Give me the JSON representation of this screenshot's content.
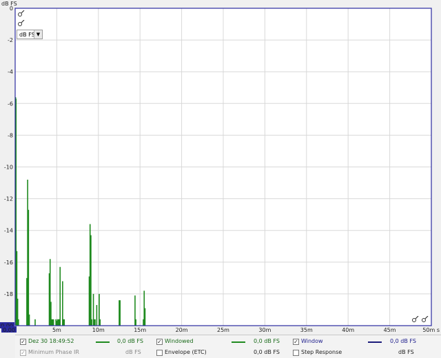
{
  "chart_data": {
    "type": "bar",
    "ylabel": "dB FS",
    "xlabel": "s",
    "ylim": [
      -20,
      0
    ],
    "xlim": [
      0,
      0.05
    ],
    "y_ticks": [
      "0",
      "-2",
      "-4",
      "-6",
      "-8",
      "-10",
      "-12",
      "-14",
      "-16",
      "-18",
      "-20,00"
    ],
    "x_ticks": [
      "0,00",
      "5m",
      "10m",
      "15m",
      "20m",
      "25m",
      "30m",
      "35m",
      "40m",
      "45m",
      "50m s"
    ],
    "grid": true,
    "series": [
      {
        "name": "Windowed",
        "color": "#1e8a1e",
        "x": [
          5e-05,
          0.0001,
          0.0002,
          0.0003,
          0.0004,
          0.0014,
          0.0015,
          0.0016,
          0.0017,
          0.0024,
          0.0041,
          0.0042,
          0.0043,
          0.0044,
          0.0045,
          0.0046,
          0.0049,
          0.005,
          0.0051,
          0.0052,
          0.0053,
          0.0054,
          0.0057,
          0.0058,
          0.0059,
          0.0089,
          0.009,
          0.0091,
          0.0092,
          0.0094,
          0.0095,
          0.0096,
          0.0098,
          0.0101,
          0.0102,
          0.0125,
          0.0126,
          0.0144,
          0.0145,
          0.0154,
          0.0155,
          0.0156
        ],
        "y": [
          -5.6,
          -5.7,
          -15.3,
          -18.3,
          -19.6,
          -17.0,
          -10.8,
          -12.7,
          -19.3,
          -19.6,
          -16.7,
          -15.8,
          -18.5,
          -19.6,
          -19.6,
          -19.6,
          -19.6,
          -19.7,
          -19.6,
          -19.6,
          -19.6,
          -16.3,
          -17.2,
          -19.6,
          -19.6,
          -16.9,
          -13.6,
          -14.3,
          -19.6,
          -18.0,
          -19.6,
          -19.6,
          -18.7,
          -18.0,
          -19.6,
          -18.4,
          -18.4,
          -18.1,
          -19.6,
          -19.6,
          -17.8,
          -18.9
        ]
      }
    ]
  },
  "yunit": {
    "label": "dB FS",
    "arrow": "▼"
  },
  "legend": {
    "row1": [
      {
        "label": "Dez 30 18:49:52",
        "checked": true,
        "value": "0,0 dB FS",
        "color": "#1e8a1e"
      },
      {
        "label": "Windowed",
        "checked": true,
        "value": "0,0 dB FS",
        "color": "#1e8a1e"
      },
      {
        "label": "Window",
        "checked": true,
        "value": "0,0 dB FS",
        "color": "#1a1a7a"
      }
    ],
    "row2": [
      {
        "label": "Minimum Phase IR",
        "checked": true,
        "value": "dB FS"
      },
      {
        "label": "Envelope (ETC)",
        "checked": false,
        "value": "0,0 dB FS"
      },
      {
        "label": "Step Response",
        "checked": false,
        "value": "dB FS"
      }
    ]
  },
  "icons": {
    "magnifier": "🔍",
    "check": "✓"
  }
}
